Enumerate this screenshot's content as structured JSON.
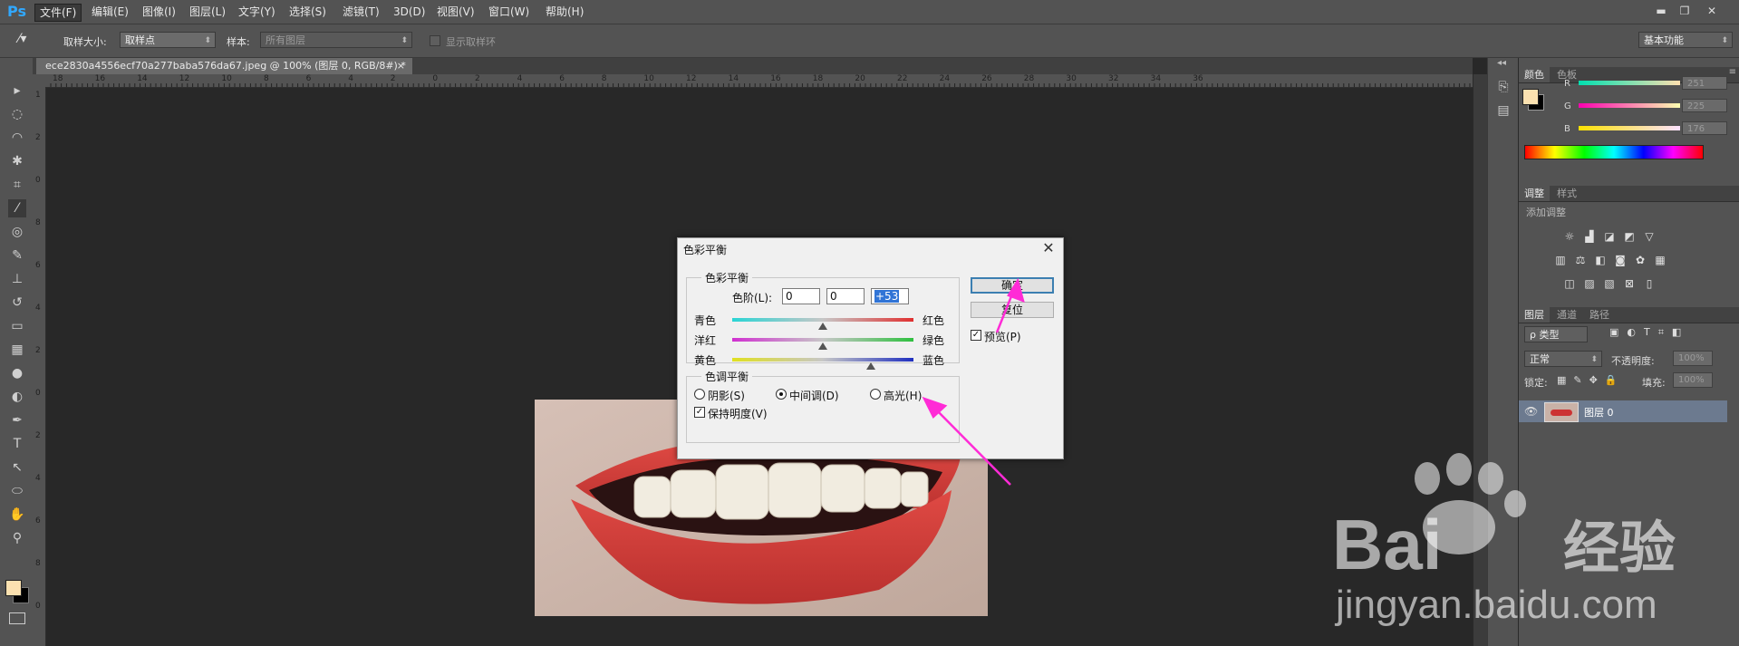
{
  "app": {
    "logo": "Ps"
  },
  "menu": {
    "items": [
      "文件(F)",
      "编辑(E)",
      "图像(I)",
      "图层(L)",
      "文字(Y)",
      "选择(S)",
      "滤镜(T)",
      "3D(D)",
      "视图(V)",
      "窗口(W)",
      "帮助(H)"
    ],
    "active_index": 0
  },
  "window_controls": {
    "minimize": "▬",
    "restore": "❐",
    "close": "✕"
  },
  "options_bar": {
    "sample_size_label": "取样大小:",
    "sample_size_value": "取样点",
    "sample_label": "样本:",
    "sample_value": "所有图层",
    "show_ring_label": "显示取样环",
    "workspace": "基本功能"
  },
  "document": {
    "tab_title": "ece2830a4556ecf70a277baba576da67.jpeg @ 100% (图层 0, RGB/8#) *",
    "tab_close": "×"
  },
  "ruler": {
    "h_ticks": [
      "18",
      "16",
      "14",
      "12",
      "10",
      "8",
      "6",
      "4",
      "2",
      "0",
      "2",
      "4",
      "6",
      "8",
      "10",
      "12",
      "14",
      "16",
      "18",
      "20",
      "22",
      "24",
      "26",
      "28",
      "30",
      "32",
      "34",
      "36"
    ],
    "v_ticks": [
      "1",
      "2",
      "0",
      "8",
      "6",
      "4",
      "2",
      "0",
      "2",
      "4",
      "6",
      "8",
      "0"
    ]
  },
  "tools": {
    "icons": [
      "move-icon",
      "marquee-icon",
      "lasso-icon",
      "magic-wand-icon",
      "crop-icon",
      "eyedropper-icon",
      "healing-icon",
      "brush-icon",
      "stamp-icon",
      "history-brush-icon",
      "eraser-icon",
      "gradient-icon",
      "blur-icon",
      "dodge-icon",
      "pen-icon",
      "type-icon",
      "path-select-icon",
      "shape-icon",
      "hand-icon",
      "zoom-icon"
    ],
    "glyphs": [
      "▸",
      "◌",
      "◠",
      "✱",
      "⌗",
      "⁄",
      "◎",
      "✎",
      "⊥",
      "↺",
      "▭",
      "▦",
      "●",
      "◐",
      "✒",
      "T",
      "↖",
      "⬭",
      "✋",
      "⚲"
    ]
  },
  "color_panel": {
    "tabs": [
      "颜色",
      "色板"
    ],
    "r_label": "R",
    "g_label": "G",
    "b_label": "B",
    "r_value": "251",
    "g_value": "225",
    "b_value": "176",
    "foreground": "#fbe1b0",
    "background": "#000000"
  },
  "adjust_panel": {
    "tabs": [
      "调整",
      "样式"
    ],
    "add_label": "添加调整"
  },
  "layers_panel": {
    "tabs": [
      "图层",
      "通道",
      "路径"
    ],
    "filter_label": "ρ 类型",
    "blend_mode": "正常",
    "opacity_label": "不透明度:",
    "opacity_value": "100%",
    "lock_label": "锁定:",
    "fill_label": "填充:",
    "fill_value": "100%",
    "layer_name": "图层 0"
  },
  "dialog": {
    "title": "色彩平衡",
    "close": "✕",
    "balance_group": "色彩平衡",
    "levels_label": "色阶(L):",
    "level1": "0",
    "level2": "0",
    "level3": "+53",
    "sliders": [
      {
        "left": "青色",
        "right": "红色",
        "value": 0
      },
      {
        "left": "洋红",
        "right": "绿色",
        "value": 0
      },
      {
        "left": "黄色",
        "right": "蓝色",
        "value": 53
      }
    ],
    "tone_group": "色调平衡",
    "shadows": "阴影(S)",
    "midtones": "中间调(D)",
    "highlights": "高光(H)",
    "preserve": "保持明度(V)",
    "ok": "确定",
    "reset": "复位",
    "preview": "预览(P)"
  },
  "watermark": {
    "brand": "Bai",
    "brand2": "经验",
    "url": "jingyan.baidu.com"
  },
  "colors": {
    "accent": "#ff2bd6",
    "panel": "#535353",
    "canvas": "#282828"
  }
}
